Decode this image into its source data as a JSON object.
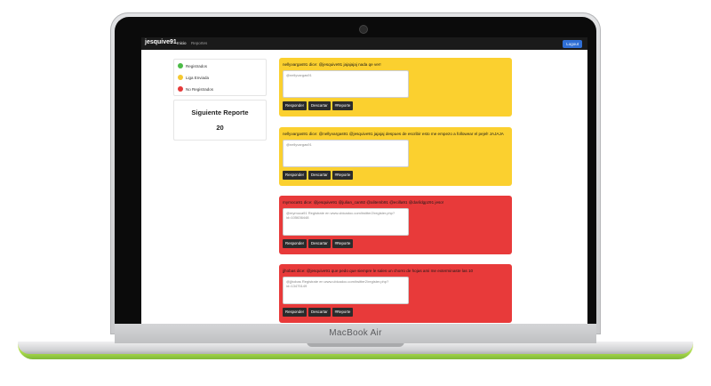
{
  "device": {
    "brand_label": "MacBook Air"
  },
  "navbar": {
    "brand": "jesquive91",
    "links": [
      "Inicio",
      "Reportes"
    ],
    "logout": "Logout"
  },
  "legend": {
    "items": [
      {
        "label": "Registrados",
        "color": "#4cbb47"
      },
      {
        "label": "Liga Enviada",
        "color": "#f5c830"
      },
      {
        "label": "No Registrados",
        "color": "#e53a3a"
      }
    ]
  },
  "report": {
    "title": "Siguiente Reporte",
    "value": "20"
  },
  "colors": {
    "yellow": "#fbd02f",
    "red": "#e83a3a"
  },
  "buttons": {
    "reply": "Responder",
    "dismiss": "Descartar",
    "report": "#Reporte"
  },
  "cards": [
    {
      "status": "yellow",
      "text": "nellyvargas91 dice: @jesquive91 jajajajaj nada qe ver!",
      "input_value": "@nellyvargas91"
    },
    {
      "status": "yellow",
      "text": "nellyvargas91 dice: @nellyvargas91 @jesquive91 jajajaj despues de escribir esto me empezo a followear el pejel! JAJAJA",
      "input_value": "@nellyvargas91"
    },
    {
      "status": "red",
      "text": "mymoca91 dice: @jesquive91 @julian_can92 @alitemb91 @ecilla91 @darildgpz91 jeso!",
      "input_value": "@mymoca91 Registrate en www.ubicadoc.com/twitter2/register.php?id=105636448"
    },
    {
      "status": "red",
      "text": "jjhobas dice: @jesquive91 que pedo que siempre le sales un chorro de hojas ami me exterminaste las 10",
      "input_value": "@jjhobas Registrate en www.ubicadoc.com/twitter2/register.php?id=13475149"
    }
  ]
}
